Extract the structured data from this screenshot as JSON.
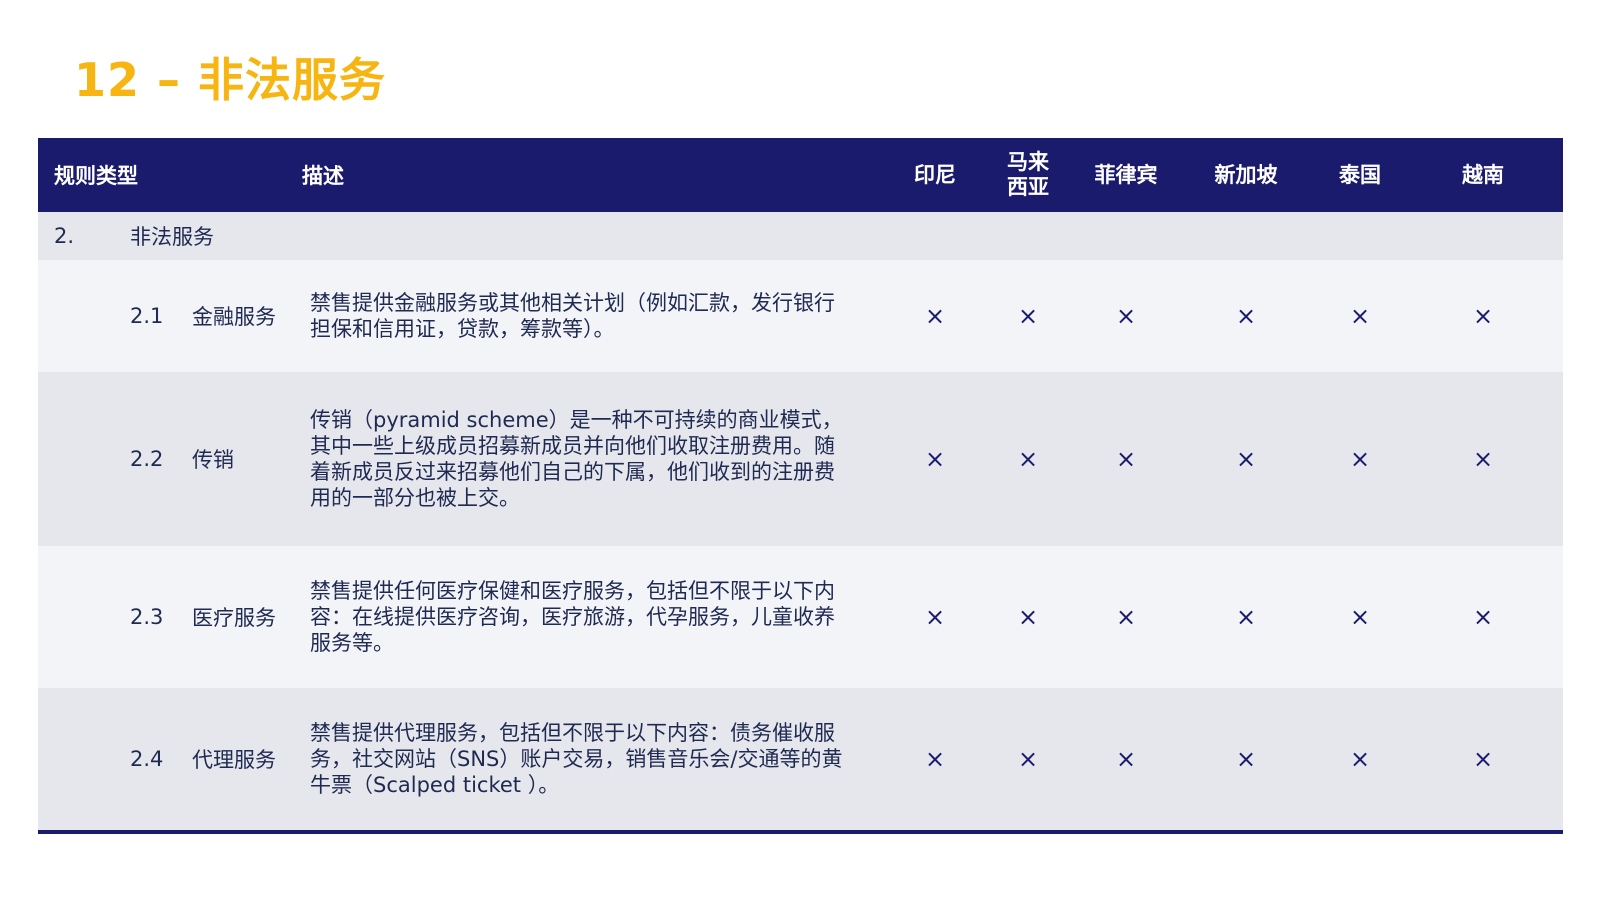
{
  "title": "12 – 非法服务",
  "table": {
    "headers": {
      "type": "规则类型",
      "description": "描述",
      "countries": [
        "印尼",
        "马来西亚",
        "菲律宾",
        "新加坡",
        "泰国",
        "越南"
      ]
    },
    "group": {
      "number": "2.",
      "label": "非法服务"
    },
    "rows": [
      {
        "number": "2.1",
        "name": "金融服务",
        "description": "禁售提供金融服务或其他相关计划（例如汇款，发行银行担保和信用证，贷款，筹款等）。",
        "marks": [
          "×",
          "×",
          "×",
          "×",
          "×",
          "×"
        ]
      },
      {
        "number": "2.2",
        "name": "传销",
        "description": "传销（pyramid scheme）是一种不可持续的商业模式，其中一些上级成员招募新成员并向他们收取注册费用。随着新成员反过来招募他们自己的下属，他们收到的注册费用的一部分也被上交。",
        "marks": [
          "×",
          "×",
          "×",
          "×",
          "×",
          "×"
        ]
      },
      {
        "number": "2.3",
        "name": "医疗服务",
        "description": "禁售提供任何医疗保健和医疗服务，包括但不限于以下内容：在线提供医疗咨询，医疗旅游，代孕服务，儿童收养服务等。",
        "marks": [
          "×",
          "×",
          "×",
          "×",
          "×",
          "×"
        ]
      },
      {
        "number": "2.4",
        "name": "代理服务",
        "description": "禁售提供代理服务，包括但不限于以下内容：债务催收服务，社交网站（SNS）账户交易，销售音乐会/交通等的黄牛票（Scalped ticket ）。",
        "marks": [
          "×",
          "×",
          "×",
          "×",
          "×",
          "×"
        ]
      }
    ]
  },
  "colors": {
    "title": "#f7b512",
    "header_bg": "#1b1b6e",
    "row_light": "#f3f4f8",
    "row_dark": "#e6e7ed"
  }
}
